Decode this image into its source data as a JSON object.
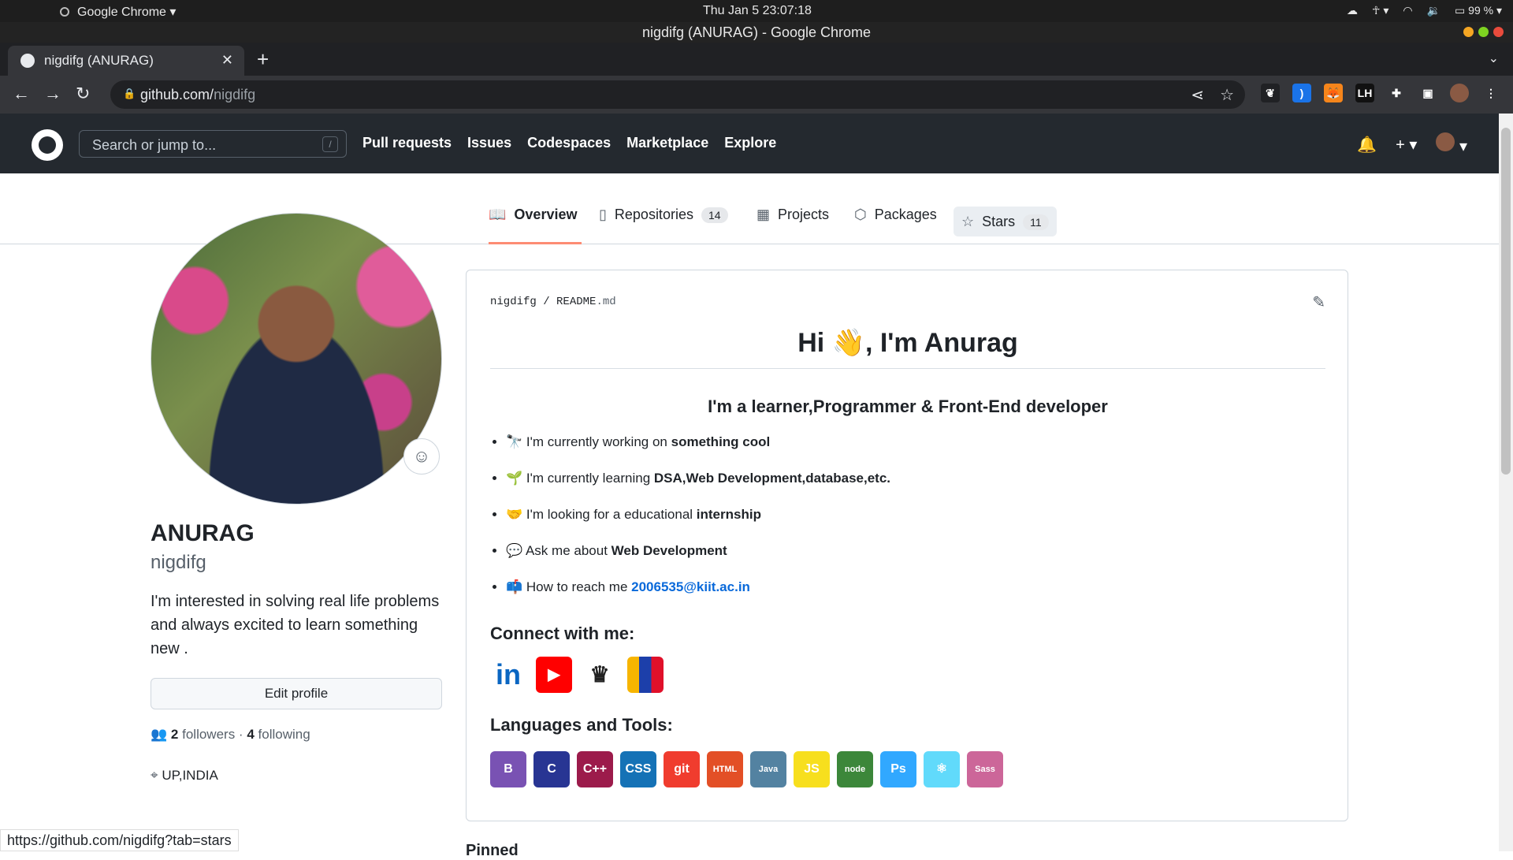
{
  "os": {
    "app_name": "Google Chrome",
    "clock": "Thu Jan 5  23:07:18",
    "battery": "99 %"
  },
  "window": {
    "title": "nigdifg (ANURAG) - Google Chrome"
  },
  "browser": {
    "tab_title": "nigdifg (ANURAG)",
    "url_host": "github.com/",
    "url_path": "nigdifg",
    "status_url": "https://github.com/nigdifg?tab=stars"
  },
  "github": {
    "search_placeholder": "Search or jump to...",
    "search_shortcut": "/",
    "nav": [
      "Pull requests",
      "Issues",
      "Codespaces",
      "Marketplace",
      "Explore"
    ]
  },
  "profile_tabs": [
    {
      "label": "Overview",
      "icon": "book-icon"
    },
    {
      "label": "Repositories",
      "count": "14",
      "icon": "repo-icon"
    },
    {
      "label": "Projects",
      "icon": "table-icon"
    },
    {
      "label": "Packages",
      "icon": "package-icon"
    },
    {
      "label": "Stars",
      "count": "11",
      "icon": "star-icon"
    }
  ],
  "profile": {
    "name": "ANURAG",
    "login": "nigdifg",
    "bio": "I'm interested in solving real life problems and always excited to learn something new .",
    "edit_label": "Edit profile",
    "followers": "2",
    "followers_label": "followers",
    "following": "4",
    "following_label": "following",
    "location": "UP,INDIA"
  },
  "readme": {
    "owner": "nigdifg",
    "file": "README",
    "ext": ".md",
    "heading": "Hi 👋, I'm Anurag",
    "subheading": "I'm a learner,Programmer & Front-End developer",
    "items": [
      {
        "emoji": "🔭",
        "text": "I'm currently working on ",
        "bold": "something cool"
      },
      {
        "emoji": "🌱",
        "text": "I'm currently learning ",
        "bold": "DSA,Web Development,database,etc."
      },
      {
        "emoji": "🤝",
        "text": "I'm looking for a educational ",
        "bold": "internship"
      },
      {
        "emoji": "💬",
        "text": "Ask me about ",
        "bold": "Web Development"
      },
      {
        "emoji": "📫",
        "text": "How to reach me ",
        "link": "2006535@kiit.ac.in"
      }
    ],
    "connect_heading": "Connect with me:",
    "connect_icons": [
      "linkedin-icon",
      "youtube-icon",
      "codechef-icon",
      "leetcode-icon"
    ],
    "tools_heading": "Languages and Tools:",
    "tools": [
      {
        "name": "bootstrap-icon",
        "label": "B",
        "caption": "Bootstrap",
        "color": "#7952b3"
      },
      {
        "name": "c-icon",
        "label": "C",
        "color": "#283593"
      },
      {
        "name": "cplusplus-icon",
        "label": "C++",
        "color": "#9c1b4b"
      },
      {
        "name": "css3-icon",
        "label": "CSS",
        "color": "#1572b6"
      },
      {
        "name": "git-icon",
        "label": "git",
        "color": "#f03c2e"
      },
      {
        "name": "html5-icon",
        "label": "HTML",
        "color": "#e34f26"
      },
      {
        "name": "java-icon",
        "label": "Java",
        "color": "#5382a1"
      },
      {
        "name": "javascript-icon",
        "label": "JS",
        "color": "#f7df1e"
      },
      {
        "name": "nodejs-icon",
        "label": "node",
        "color": "#3c873a"
      },
      {
        "name": "photoshop-icon",
        "label": "Ps",
        "color": "#31a8ff"
      },
      {
        "name": "react-icon",
        "label": "⚛",
        "caption": "React",
        "color": "#61dafb"
      },
      {
        "name": "sass-icon",
        "label": "Sass",
        "color": "#cc6699"
      }
    ]
  },
  "pinned_heading": "Pinned"
}
